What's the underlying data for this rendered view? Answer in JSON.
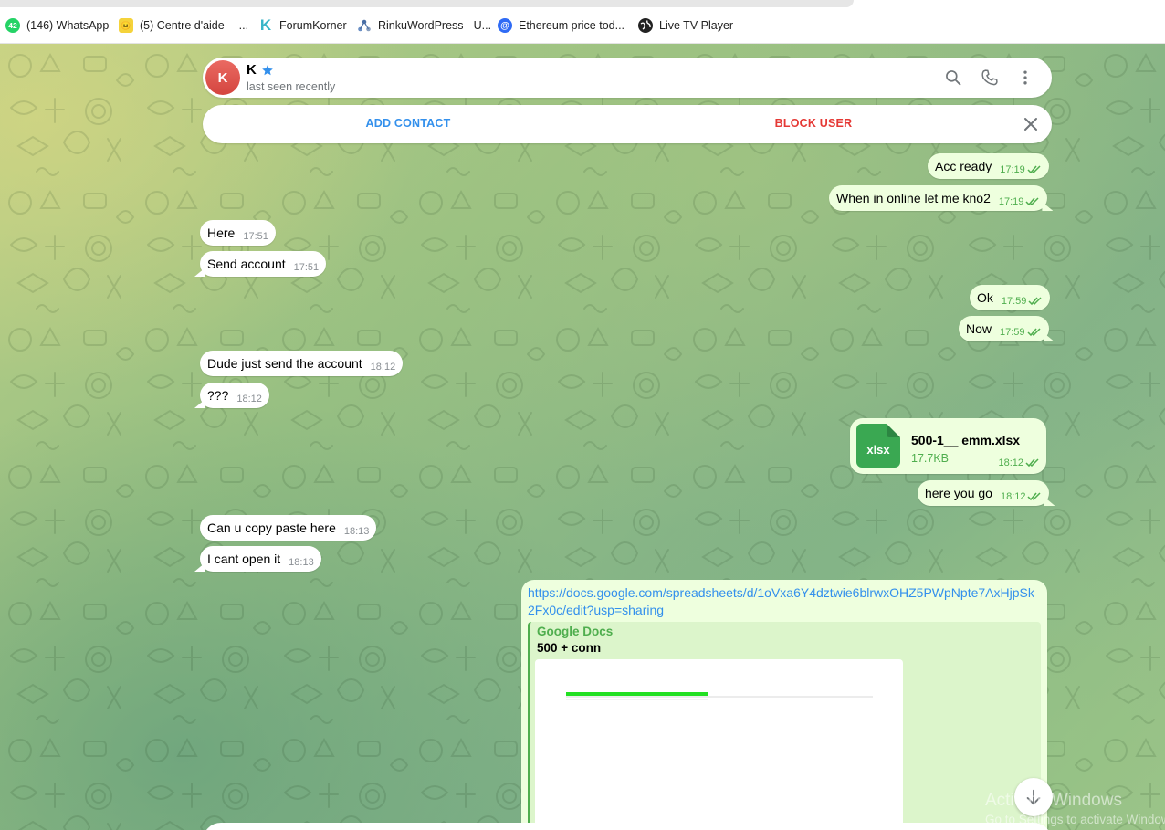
{
  "bookmarks": [
    {
      "label": "(146) WhatsApp",
      "icon": "whatsapp-icon",
      "badge": "42"
    },
    {
      "label": "(5) Centre d'aide —...",
      "icon": "help-center-icon",
      "badge": "😐"
    },
    {
      "label": "ForumKorner",
      "icon": "forumkorner-icon",
      "badge": "K"
    },
    {
      "label": "RinkuWordPress - U...",
      "icon": "rinku-icon",
      "badge": ""
    },
    {
      "label": "Ethereum price tod...",
      "icon": "ethereum-icon",
      "badge": "@"
    },
    {
      "label": "Live TV Player",
      "icon": "globe-icon",
      "badge": "●"
    }
  ],
  "chat": {
    "peer": {
      "initial": "K",
      "name": "K",
      "status": "last seen recently",
      "avatar_color": "#e0554e"
    },
    "actions": {
      "add_contact": "ADD CONTACT",
      "block_user": "BLOCK USER"
    },
    "messages": [
      {
        "dir": "out",
        "text": "Acc ready",
        "time": "17:19"
      },
      {
        "dir": "out",
        "text": "When in online let me kno2",
        "time": "17:19"
      },
      {
        "dir": "in",
        "text": "Here",
        "time": "17:51"
      },
      {
        "dir": "in",
        "text": "Send account",
        "time": "17:51"
      },
      {
        "dir": "out",
        "text": "Ok",
        "time": "17:59"
      },
      {
        "dir": "out",
        "text": "Now",
        "time": "17:59"
      },
      {
        "dir": "in",
        "text": "Dude just send the account",
        "time": "18:12"
      },
      {
        "dir": "in",
        "text": "???",
        "time": "18:12"
      },
      {
        "dir": "out",
        "text": "here you go",
        "time": "18:12"
      },
      {
        "dir": "in",
        "text": "Can u copy paste here",
        "time": "18:13"
      },
      {
        "dir": "in",
        "text": "I cant open it",
        "time": "18:13"
      }
    ],
    "file": {
      "ext": "xlsx",
      "name": "500-1__ emm.xlsx",
      "size": "17.7KB",
      "time": "18:12"
    },
    "link": {
      "url": "https://docs.google.com/spreadsheets/d/1oVxa6Y4dztwie6blrwxOHZ5PWpNpte7AxHjpSk2Fx0c/edit?usp=sharing",
      "site": "Google Docs",
      "title": "500 + conn"
    },
    "colors": {
      "accent": "#3390ec",
      "danger": "#e53935",
      "outgoing_bubble": "#eeffde",
      "read_ticks": "#4fae4e"
    }
  },
  "watermark": {
    "title": "Activate Windows",
    "subtitle": "Go to Settings to activate Windows."
  }
}
